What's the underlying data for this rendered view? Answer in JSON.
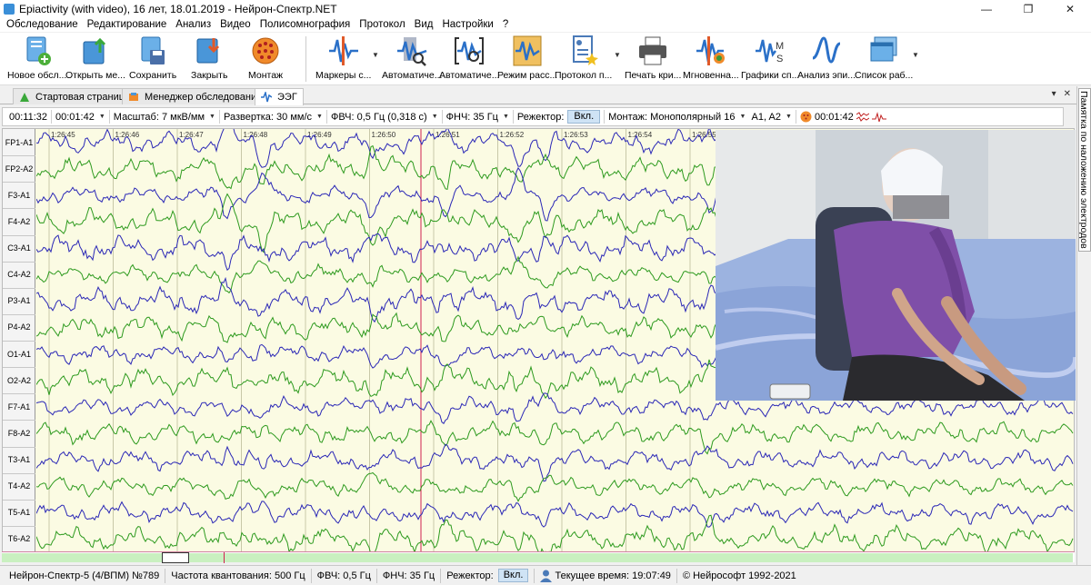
{
  "window": {
    "title": "Epiactivity (with video), 16 лет, 18.01.2019 - Нейрон-Спектр.NET",
    "minimize": "—",
    "maximize": "❐",
    "close": "✕"
  },
  "menu": [
    "Обследование",
    "Редактирование",
    "Анализ",
    "Видео",
    "Полисомнография",
    "Протокол",
    "Вид",
    "Настройки",
    "?"
  ],
  "toolbar": {
    "buttons": [
      {
        "label": "Новое обсл...",
        "icon": "new-exam-icon"
      },
      {
        "label": "Открыть ме...",
        "icon": "open-icon"
      },
      {
        "label": "Сохранить",
        "icon": "save-icon"
      },
      {
        "label": "Закрыть",
        "icon": "close-exam-icon"
      },
      {
        "label": "Монтаж",
        "icon": "montage-head-icon"
      },
      {
        "label": "Маркеры с...",
        "icon": "markers-icon"
      },
      {
        "label": "Автоматиче...",
        "icon": "auto-analysis-icon"
      },
      {
        "label": "Автоматиче...",
        "icon": "auto-detect-icon"
      },
      {
        "label": "Режим расс...",
        "icon": "mode-icon"
      },
      {
        "label": "Протокол п...",
        "icon": "protocol-icon"
      },
      {
        "label": "Печать кри...",
        "icon": "printer-icon"
      },
      {
        "label": "Мгновенна...",
        "icon": "instant-map-icon"
      },
      {
        "label": "Графики сп...",
        "icon": "spectra-graph-icon"
      },
      {
        "label": "Анализ эпи...",
        "icon": "epi-analysis-icon"
      },
      {
        "label": "Список раб...",
        "icon": "work-list-icon"
      }
    ]
  },
  "tabs": [
    {
      "label": "Стартовая страница",
      "active": false
    },
    {
      "label": "Менеджер обследований",
      "active": false
    },
    {
      "label": "ЭЭГ",
      "active": true
    }
  ],
  "tab_controls": {
    "menu": "▾",
    "close": "✕"
  },
  "side_panel": {
    "label": "Памятка по наложению электродов"
  },
  "eeg_toolbar": {
    "time": "00:11:32",
    "epoch": "00:01:42",
    "scale_label": "Масштаб:",
    "scale_value": "7 мкВ/мм",
    "sweep_label": "Развертка:",
    "sweep_value": "30 мм/с",
    "hpf_label": "ФВЧ:",
    "hpf_value": "0,5 Гц (0,318 с)",
    "lpf_label": "ФНЧ:",
    "lpf_value": "35 Гц",
    "notch_label": "Режектор:",
    "notch_value": "Вкл.",
    "montage_label": "Монтаж:",
    "montage_value": "Монополярный 16",
    "ref_value": "A1, A2",
    "video_time": "00:01:42"
  },
  "channels": [
    "FP1-A1",
    "FP2-A2",
    "F3-A1",
    "F4-A2",
    "C3-A1",
    "C4-A2",
    "P3-A1",
    "P4-A2",
    "O1-A1",
    "O2-A2",
    "F7-A1",
    "F8-A2",
    "T3-A1",
    "T4-A2",
    "T5-A1",
    "T6-A2"
  ],
  "time_marks": [
    "1:26:45",
    "1:26:46",
    "1:26:47",
    "1:26:48",
    "1:26:49",
    "1:26:50",
    "1:26:51",
    "1:26:52",
    "1:26:53",
    "1:26:54",
    "1:26:55"
  ],
  "colors": {
    "trace_a": "#2d9a1e",
    "trace_b": "#2a27b6",
    "background": "#fbfbe3",
    "cursor": "#d02050"
  },
  "status": {
    "device": "Нейрон-Спектр-5 (4/ВПМ) №789",
    "rate_label": "Частота квантования:",
    "rate_value": "500 Гц",
    "hpf": "ФВЧ:",
    "hpf_value": "0,5 Гц",
    "lpf": "ФНЧ:",
    "lpf_value": "35 Гц",
    "notch": "Режектор:",
    "notch_value": "Вкл.",
    "time_label": "Текущее время:",
    "time_value": "19:07:49",
    "copyright": "© Нейрософт 1992-2021"
  }
}
